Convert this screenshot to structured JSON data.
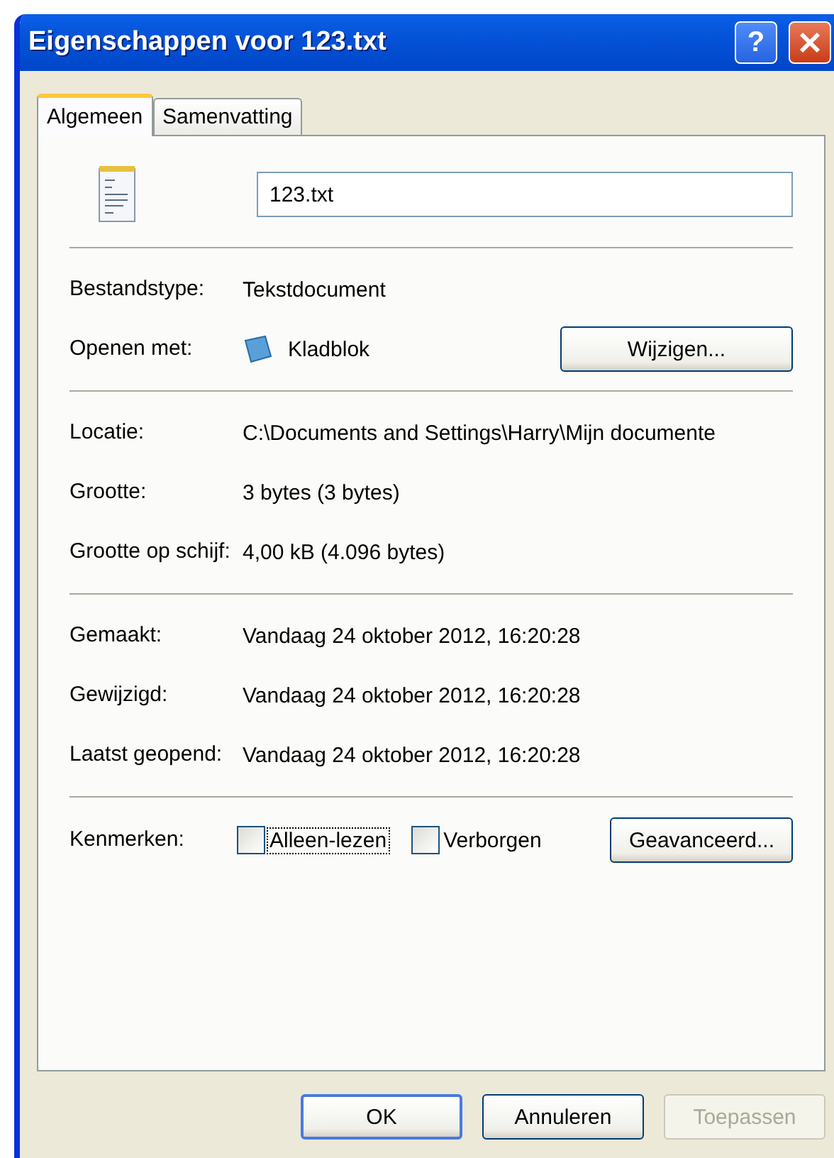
{
  "window": {
    "title": "Eigenschappen voor 123.txt",
    "help_label": "?"
  },
  "tabs": [
    {
      "label": "Algemeen",
      "selected": true
    },
    {
      "label": "Samenvatting",
      "selected": false
    }
  ],
  "file_name": "123.txt",
  "sections": [
    [
      {
        "label": "Bestandstype:",
        "value": "Tekstdocument"
      },
      {
        "label": "Openen met:",
        "value": "Kladblok",
        "kind": "app",
        "button": "Wijzigen..."
      }
    ],
    [
      {
        "label": "Locatie:",
        "value": "C:\\Documents and Settings\\Harry\\Mijn documente"
      },
      {
        "label": "Grootte:",
        "value": "3 bytes (3 bytes)"
      },
      {
        "label": "Grootte op schijf:",
        "value": "4,00 kB (4.096 bytes)"
      }
    ],
    [
      {
        "label": "Gemaakt:",
        "value": "Vandaag 24 oktober 2012, 16:20:28"
      },
      {
        "label": "Gewijzigd:",
        "value": "Vandaag 24 oktober 2012, 16:20:28"
      },
      {
        "label": "Laatst geopend:",
        "value": "Vandaag 24 oktober 2012, 16:20:28"
      }
    ]
  ],
  "attributes": {
    "label": "Kenmerken:",
    "checkboxes": [
      {
        "label": "Alleen-lezen",
        "checked": false,
        "focused": true
      },
      {
        "label": "Verborgen",
        "checked": false,
        "focused": false
      }
    ],
    "button": "Geavanceerd..."
  },
  "buttons": [
    {
      "label": "OK",
      "disabled": false,
      "default": true
    },
    {
      "label": "Annuleren",
      "disabled": false,
      "default": false
    },
    {
      "label": "Toepassen",
      "disabled": true,
      "default": false
    }
  ]
}
